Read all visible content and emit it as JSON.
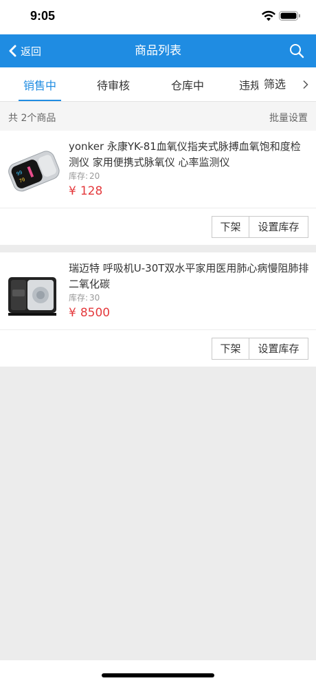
{
  "status_bar": {
    "time": "9:05"
  },
  "nav": {
    "back_label": "返回",
    "title": "商品列表"
  },
  "tabs": [
    {
      "label": "销售中"
    },
    {
      "label": "待审核"
    },
    {
      "label": "仓库中"
    },
    {
      "label": "违规"
    }
  ],
  "filter": {
    "label": "筛选"
  },
  "summary": {
    "count_text": "共 2个商品",
    "batch_label": "批量设置"
  },
  "products": [
    {
      "name": "yonker 永康YK-81血氧仪指夹式脉搏血氧饱和度检测仪 家用便携式脉氧仪 心率监测仪",
      "stock_label": "库存:",
      "stock": "20",
      "currency": "¥",
      "price": "128",
      "actions": {
        "offshelf": "下架",
        "set_stock": "设置库存"
      }
    },
    {
      "name": "瑞迈特 呼吸机U-30T双水平家用医用肺心病慢阻肺排二氧化碳",
      "stock_label": "库存:",
      "stock": "30",
      "currency": "¥",
      "price": "8500",
      "actions": {
        "offshelf": "下架",
        "set_stock": "设置库存"
      }
    }
  ],
  "colors": {
    "accent": "#1f8ce2",
    "price": "#e4393c",
    "background": "#ececec"
  },
  "icons": {
    "back": "chevron-left-icon",
    "search": "search-icon",
    "filter_arrow": "chevron-right-icon",
    "wifi": "wifi-icon",
    "battery": "battery-icon"
  }
}
